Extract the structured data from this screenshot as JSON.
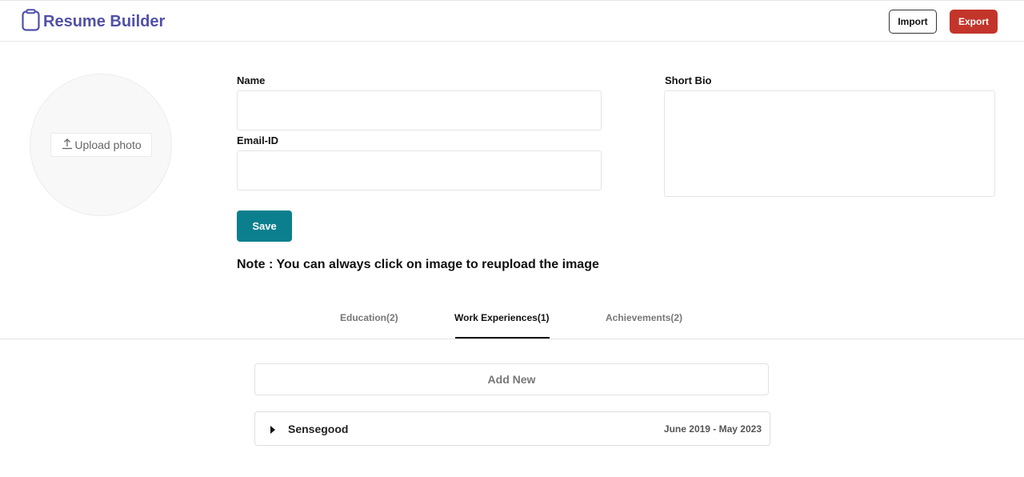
{
  "header": {
    "title": "Resume Builder",
    "import_label": "Import",
    "export_label": "Export",
    "brand_color": "#5050a8",
    "export_color": "#c3352b"
  },
  "profile": {
    "upload_label": "Upload photo",
    "name_label": "Name",
    "name_value": "",
    "email_label": "Email-ID",
    "email_value": "",
    "bio_label": "Short Bio",
    "bio_value": "",
    "save_label": "Save",
    "save_color": "#0b7f8e",
    "note": "Note : You can always click on image to reupload the image"
  },
  "tabs": [
    {
      "label": "Education(2)",
      "active": false
    },
    {
      "label": "Work Experiences(1)",
      "active": true
    },
    {
      "label": "Achievements(2)",
      "active": false
    }
  ],
  "section": {
    "add_new_label": "Add New",
    "items": [
      {
        "name": "Sensegood",
        "dates": "June 2019 - May 2023",
        "expanded": false
      }
    ]
  },
  "icons": {
    "brand": "clipboard-icon",
    "upload": "upload-icon",
    "caret": "caret-right-icon"
  }
}
